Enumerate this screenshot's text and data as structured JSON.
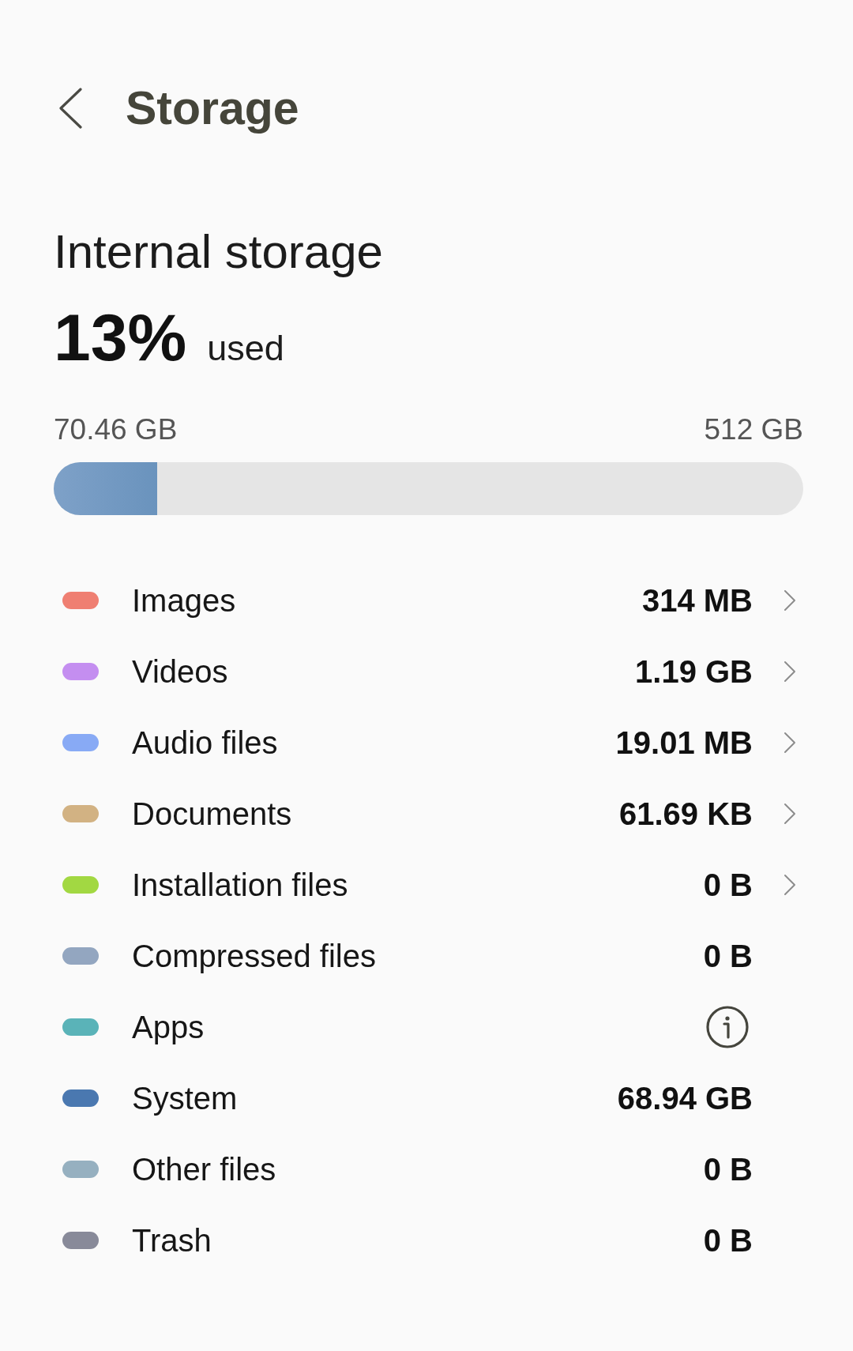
{
  "header": {
    "title": "Storage"
  },
  "storage": {
    "title": "Internal storage",
    "percent": "13%",
    "percent_label": "used",
    "used": "70.46 GB",
    "total": "512 GB",
    "level": 0.1376
  },
  "categories": [
    {
      "name": "Images",
      "size": "314 MB",
      "color": "#ef7f72",
      "kind": "link"
    },
    {
      "name": "Videos",
      "size": "1.19 GB",
      "color": "#c48ef0",
      "kind": "link"
    },
    {
      "name": "Audio files",
      "size": "19.01 MB",
      "color": "#88aaf5",
      "kind": "link"
    },
    {
      "name": "Documents",
      "size": "61.69 KB",
      "color": "#d2b283",
      "kind": "link"
    },
    {
      "name": "Installation files",
      "size": "0 B",
      "color": "#a2d842",
      "kind": "link"
    },
    {
      "name": "Compressed files",
      "size": "0 B",
      "color": "#93a6c0",
      "kind": "plain"
    },
    {
      "name": "Apps",
      "color": "#5ab3b8",
      "kind": "info"
    },
    {
      "name": "System",
      "size": "68.94 GB",
      "color": "#4a78b0",
      "kind": "plain"
    },
    {
      "name": "Other files",
      "size": "0 B",
      "color": "#96b0c0",
      "kind": "plain"
    },
    {
      "name": "Trash",
      "size": "0 B",
      "color": "#888a99",
      "kind": "plain"
    }
  ]
}
